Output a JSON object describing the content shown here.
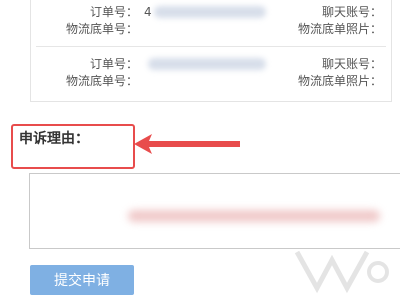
{
  "records": [
    {
      "order_label": "订单号：",
      "order_value_visible": "4",
      "chat_label": "聊天账号：",
      "logistics_label": "物流底单号：",
      "photo_label": "物流底单照片："
    },
    {
      "order_label": "订单号：",
      "order_value_visible": "",
      "chat_label": "聊天账号：",
      "logistics_label": "物流底单号：",
      "photo_label": "物流底单照片："
    }
  ],
  "appeal": {
    "label": "申诉理由：",
    "textarea_value": "",
    "highlight_color": "#e84c4c"
  },
  "submit": {
    "label": "提交申请",
    "color": "#7fb0e3"
  },
  "icons": {
    "annotation_arrow": "red-arrow-icon",
    "watermark": "watermark-logo-icon"
  }
}
